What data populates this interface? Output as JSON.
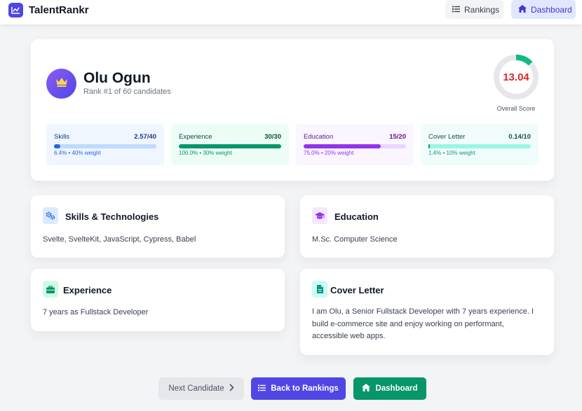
{
  "header": {
    "brand": "TalentRankr",
    "nav": {
      "rankings": "Rankings",
      "dashboard": "Dashboard"
    }
  },
  "candidate": {
    "name": "Olu Ogun",
    "rank_text": "Rank #1 of 60 candidates",
    "overall_score": "13.04",
    "overall_fraction": 0.1304,
    "overall_label": "Overall Score"
  },
  "metrics": [
    {
      "name": "Skills",
      "score": "2.57/40",
      "sub": "6.4% • 40% weight",
      "fraction": 0.064
    },
    {
      "name": "Experience",
      "score": "30/30",
      "sub": "100.0% • 30% weight",
      "fraction": 1.0
    },
    {
      "name": "Education",
      "score": "15/20",
      "sub": "75.0% • 20% weight",
      "fraction": 0.75
    },
    {
      "name": "Cover Letter",
      "score": "0.14/10",
      "sub": "1.4% • 10% weight",
      "fraction": 0.014
    }
  ],
  "sections": {
    "skills": {
      "title": "Skills & Technologies",
      "body": "Svelte, SvelteKit, JavaScript, Cypress, Babel"
    },
    "education": {
      "title": "Education",
      "body": "M.Sc. Computer Science"
    },
    "experience": {
      "title": "Experience",
      "body": "7 years as Fullstack Developer"
    },
    "cover_letter": {
      "title": "Cover Letter",
      "body": "I am Olu, a Senior Fullstack Developer with 7 years experience. I build e-commerce site and enjoy working on performant, accessible web apps."
    }
  },
  "actions": {
    "next": "Next Candidate",
    "back": "Back to Rankings",
    "dashboard": "Dashboard"
  },
  "colors": {
    "primary": "#4f46e5",
    "success": "#059669",
    "score_text": "#dc2626",
    "ring_fill": "#10b981",
    "ring_track": "#e5e7eb"
  }
}
